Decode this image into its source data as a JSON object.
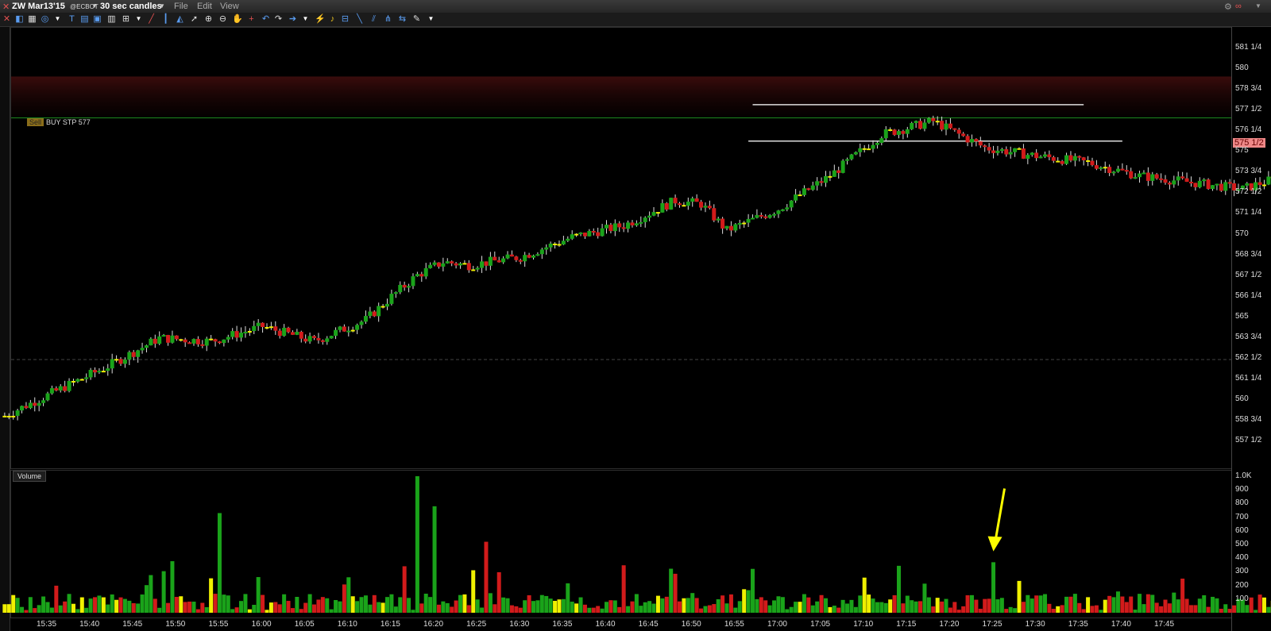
{
  "window": {
    "symbol": "ZW Mar13'15",
    "exchange": "@ECBOT",
    "interval": "30 sec candles",
    "menus": [
      "File",
      "Edit",
      "View"
    ]
  },
  "order": {
    "label": "BUY STP 577",
    "tag": "Sell"
  },
  "last_price": "575 1/2",
  "volume_panel": {
    "label": "Volume"
  },
  "price_axis": [
    "581 1/4",
    "580",
    "578 3/4",
    "577 1/2",
    "576 1/4",
    "575",
    "573 3/4",
    "572 1/2",
    "571 1/4",
    "570",
    "568 3/4",
    "567 1/2",
    "566 1/4",
    "565",
    "563 3/4",
    "562 1/2",
    "561 1/4",
    "560",
    "558 3/4",
    "557 1/2"
  ],
  "volume_axis": [
    "1.0K",
    "900",
    "800",
    "700",
    "600",
    "500",
    "400",
    "300",
    "200",
    "100"
  ],
  "time_axis": [
    "15:35",
    "15:40",
    "15:45",
    "15:50",
    "15:55",
    "16:00",
    "16:05",
    "16:10",
    "16:15",
    "16:20",
    "16:25",
    "16:30",
    "16:35",
    "16:40",
    "16:45",
    "16:50",
    "16:55",
    "17:00",
    "17:05",
    "17:10",
    "17:15",
    "17:20",
    "17:25",
    "17:30",
    "17:35",
    "17:40",
    "17:45"
  ],
  "colors": {
    "up": "#1aa31a",
    "down": "#d21b1b",
    "flat": "#f0f000",
    "accent": "#5a9cf0",
    "annotation": "#ffff00"
  },
  "chart_data": {
    "type": "candlestick",
    "interval_seconds": 30,
    "ylim": [
      557,
      582
    ],
    "close_path": [
      [
        15.5,
        559
      ],
      [
        15.6,
        560.5
      ],
      [
        15.7,
        562
      ],
      [
        15.8,
        563.7
      ],
      [
        15.9,
        563.5
      ],
      [
        16.0,
        564.4
      ],
      [
        16.1,
        563.5
      ],
      [
        16.2,
        564.8
      ],
      [
        16.25,
        566.2
      ],
      [
        16.3,
        567.5
      ],
      [
        16.35,
        568.3
      ],
      [
        16.4,
        568.1
      ],
      [
        16.5,
        568.6
      ],
      [
        16.6,
        569.8
      ],
      [
        16.7,
        570.5
      ],
      [
        16.8,
        572
      ],
      [
        16.85,
        571.8
      ],
      [
        16.9,
        570.2
      ],
      [
        17.0,
        571.5
      ],
      [
        17.1,
        573.5
      ],
      [
        17.2,
        576
      ],
      [
        17.3,
        576.8
      ],
      [
        17.4,
        575.2
      ],
      [
        17.5,
        574.7
      ],
      [
        17.6,
        574.3
      ],
      [
        17.7,
        573.5
      ],
      [
        17.8,
        573.1
      ],
      [
        17.9,
        572.7
      ],
      [
        18.0,
        573.7
      ],
      [
        18.1,
        574.3
      ],
      [
        18.2,
        575
      ],
      [
        18.3,
        575.8
      ],
      [
        18.4,
        575.5
      ],
      [
        18.5,
        576.2
      ],
      [
        18.6,
        576.3
      ],
      [
        18.7,
        577.2
      ],
      [
        18.8,
        577.8
      ],
      [
        18.9,
        577.9
      ],
      [
        19.0,
        578.3
      ],
      [
        19.1,
        579.3
      ],
      [
        19.2,
        579.8
      ],
      [
        19.3,
        578.9
      ],
      [
        19.4,
        578.3
      ],
      [
        19.5,
        578.9
      ],
      [
        19.6,
        579.6
      ],
      [
        19.7,
        579.2
      ],
      [
        19.8,
        578.6
      ],
      [
        19.9,
        578.1
      ],
      [
        20.0,
        577.9
      ],
      [
        20.1,
        577.3
      ],
      [
        20.2,
        576.6
      ],
      [
        20.3,
        575.7
      ],
      [
        20.4,
        575.2
      ],
      [
        20.5,
        575.3
      ]
    ],
    "volume_peaks": [
      {
        "time": "16:18",
        "value": 1000,
        "dir": "up"
      },
      {
        "time": "16:20",
        "value": 780,
        "dir": "up"
      },
      {
        "time": "15:55",
        "value": 730,
        "dir": "up"
      },
      {
        "time": "16:26",
        "value": 520,
        "dir": "down"
      },
      {
        "time": "17:25",
        "value": 370,
        "dir": "up"
      }
    ],
    "levels": {
      "buy_stop": 577,
      "resistance_upper": 577.8,
      "support_lower": 575.6,
      "dashed": 562.4
    }
  }
}
